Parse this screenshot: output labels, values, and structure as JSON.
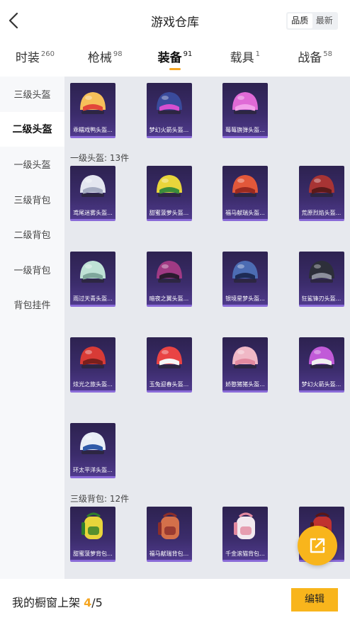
{
  "header": {
    "title": "游戏仓库",
    "sort": [
      "品质",
      "最新"
    ],
    "active_sort": 0
  },
  "tabs": [
    {
      "label": "时装",
      "count": "260"
    },
    {
      "label": "枪械",
      "count": "98"
    },
    {
      "label": "装备",
      "count": "91"
    },
    {
      "label": "载具",
      "count": "1"
    },
    {
      "label": "战备",
      "count": "58"
    }
  ],
  "sidebar": [
    "三级头盔",
    "二级头盔",
    "一级头盔",
    "三级背包",
    "二级背包",
    "一级背包",
    "背包挂件"
  ],
  "sections": [
    {
      "title": "",
      "items": [
        {
          "name": "乖糯戏鸭头盔...",
          "color": "#f6c05a",
          "accent": "#e2463a"
        },
        {
          "name": "梦幻火箭头盔...",
          "color": "#3a4b9c",
          "accent": "#d64fd0"
        },
        {
          "name": "莓莓旗弹头盔...",
          "color": "#e06ad6",
          "accent": "#f2a0ea"
        }
      ]
    },
    {
      "title": "一级头盔: 13件",
      "items": [
        {
          "name": "鸢尾迷雾头盔...",
          "color": "#e4e6f0",
          "accent": "#a6acc2"
        },
        {
          "name": "甜蜜菠萝头盔...",
          "color": "#e8d53b",
          "accent": "#3c8d3a"
        },
        {
          "name": "福马献瑞头盔...",
          "color": "#e2583a",
          "accent": "#9a2a20"
        },
        {
          "name": "荒原烈焰头盔...",
          "color": "#a83434",
          "accent": "#5a1a1a"
        },
        {
          "name": "雨过天青头盔...",
          "color": "#bfe2d6",
          "accent": "#7fa79c"
        },
        {
          "name": "暗夜之翼头盔...",
          "color": "#a03a84",
          "accent": "#2b1b2f"
        },
        {
          "name": "银境星梦头盔...",
          "color": "#4c6cb3",
          "accent": "#1e2b55"
        },
        {
          "name": "狂鲨锋刃头盔...",
          "color": "#2d2f3a",
          "accent": "#8c8f9c"
        },
        {
          "name": "炫光之旅头盔...",
          "color": "#d83b36",
          "accent": "#7a1f1c"
        },
        {
          "name": "玉兔迎春头盔...",
          "color": "#e94444",
          "accent": "#f6f6f6"
        },
        {
          "name": "娇憨猪猪头盔...",
          "color": "#f0b8c6",
          "accent": "#e28aa0"
        },
        {
          "name": "梦幻火箭头盔...",
          "color": "#c15ad8",
          "accent": "#f0f0f0"
        },
        {
          "name": "环太平洋头盔...",
          "color": "#e8eef6",
          "accent": "#2e5aa8"
        }
      ]
    },
    {
      "title": "三级背包: 12件",
      "items": [
        {
          "name": "甜蜜菠萝背包...",
          "color": "#e8d53b",
          "accent": "#2f7d2c"
        },
        {
          "name": "福马献瑞背包...",
          "color": "#d4704a",
          "accent": "#8c2e2a"
        },
        {
          "name": "千金滚猫背包...",
          "color": "#f2e9ef",
          "accent": "#e28aa0"
        },
        {
          "name": "",
          "color": "#c0322f",
          "accent": "#5a1616"
        }
      ]
    }
  ],
  "footer": {
    "label": "我的橱窗上架",
    "current": "4",
    "sep": "/",
    "total": "5",
    "edit": "编辑"
  }
}
